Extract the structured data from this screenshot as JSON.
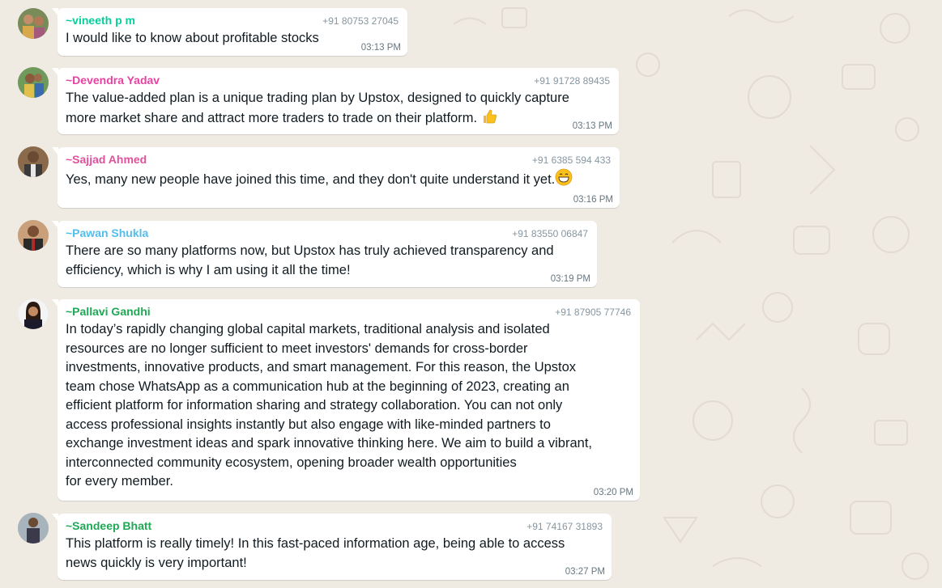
{
  "colors": {
    "chat_background": "#efeae2",
    "bubble": "#ffffff",
    "meta_text": "#8696a0"
  },
  "messages": [
    {
      "sender": "~vineeth p m",
      "sender_color": "#06cf9c",
      "phone": "+91 80753 27045",
      "text": "I would like to know about profitable stocks",
      "time": "03:13 PM"
    },
    {
      "sender": "~Devendra Yadav",
      "sender_color": "#e542a3",
      "phone": "+91 91728 89435",
      "text": "The value-added plan is a unique trading plan by Upstox, designed to quickly capture\nmore market share and attract more traders to trade on their platform. ",
      "emoji": "thumbs-up",
      "time": "03:13 PM"
    },
    {
      "sender": "~Sajjad Ahmed",
      "sender_color": "#e0529c",
      "phone": "+91 6385 594 433",
      "text": "Yes, many new people have joined this time, and they don't quite understand it yet.",
      "emoji": "grinning-face",
      "time": "03:16 PM"
    },
    {
      "sender": "~Pawan Shukla",
      "sender_color": "#53bdeb",
      "phone": "+91 83550 06847",
      "text": "There are so many platforms now, but Upstox has truly achieved transparency and\nefficiency, which is why I am using it all the time!",
      "time": "03:19 PM"
    },
    {
      "sender": "~Pallavi Gandhi",
      "sender_color": "#1fa855",
      "phone": "+91 87905 77746",
      "text": "In today’s rapidly changing global capital markets, traditional analysis and isolated\nresources are no longer sufficient to meet investors' demands for cross-border\ninvestments, innovative products, and smart management. For this reason, the Upstox\nteam chose WhatsApp as a communication hub at the beginning of 2023, creating an\nefficient platform for information sharing and strategy collaboration. You can not only\naccess professional insights instantly but also engage with like-minded partners to\nexchange investment ideas and spark innovative thinking here. We aim to build a vibrant,\ninterconnected community ecosystem, opening broader wealth opportunities\nfor every member.",
      "time": "03:20 PM"
    },
    {
      "sender": "~Sandeep Bhatt",
      "sender_color": "#1fa855",
      "phone": "+91 74167 31893",
      "text": "This platform is really timely! In this fast-paced information age, being able to access\nnews quickly is very important!",
      "time": "03:27 PM"
    }
  ]
}
